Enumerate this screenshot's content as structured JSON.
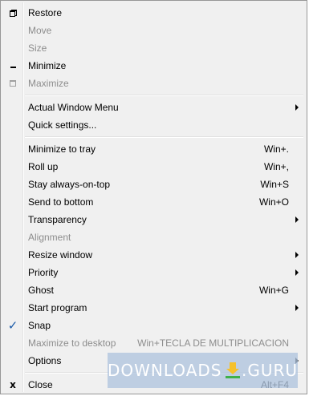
{
  "menu": {
    "items": [
      {
        "label": "Restore",
        "icon": "restore-icon"
      },
      {
        "label": "Move"
      },
      {
        "label": "Size"
      },
      {
        "label": "Minimize",
        "icon": "minimize-icon"
      },
      {
        "label": "Maximize",
        "icon": "maximize-icon"
      },
      {
        "label": "Actual Window Menu"
      },
      {
        "label": "Quick settings..."
      },
      {
        "label": "Minimize to tray",
        "shortcut": "Win+."
      },
      {
        "label": "Roll up",
        "shortcut": "Win+,"
      },
      {
        "label": "Stay always-on-top",
        "shortcut": "Win+S"
      },
      {
        "label": "Send to bottom",
        "shortcut": "Win+O"
      },
      {
        "label": "Transparency"
      },
      {
        "label": "Alignment"
      },
      {
        "label": "Resize window"
      },
      {
        "label": "Priority"
      },
      {
        "label": "Ghost",
        "shortcut": "Win+G"
      },
      {
        "label": "Start program"
      },
      {
        "label": "Snap",
        "icon": "checkmark-icon"
      },
      {
        "label": "Maximize to desktop",
        "shortcut": "Win+TECLA DE MULTIPLICACION"
      },
      {
        "label": "Options"
      },
      {
        "label": "Close",
        "shortcut": "Alt+F4",
        "icon": "close-icon"
      }
    ]
  },
  "watermark": {
    "left": "DOWNLOADS",
    "right": ".GURU"
  },
  "colors": {
    "menu_bg": "#f0f0f0",
    "disabled_text": "#8d8d8d",
    "check": "#1a5aa8",
    "watermark_bg": "#b0c4de"
  }
}
